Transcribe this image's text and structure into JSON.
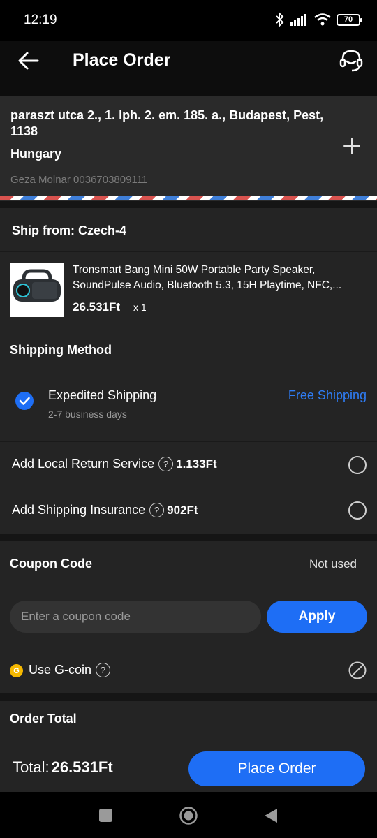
{
  "status_bar": {
    "time": "12:19",
    "battery": "70"
  },
  "app_bar": {
    "title": "Place Order"
  },
  "address": {
    "line": "paraszt utca 2., 1. lph. 2. em. 185. a., Budapest, Pest, 1138",
    "country": "Hungary",
    "contact": "Geza Molnar  0036703809111"
  },
  "ship_from": {
    "label": "Ship from: Czech-4"
  },
  "product": {
    "title_line1": "Tronsmart Bang Mini 50W Portable Party Speaker,",
    "title_line2": "SoundPulse Audio,  Bluetooth 5.3, 15H Playtime, NFC,...",
    "price": "26.531Ft",
    "qty": "x 1"
  },
  "shipping": {
    "heading": "Shipping Method",
    "method": "Expedited Shipping",
    "days": "2-7 business days",
    "price_label": "Free Shipping"
  },
  "addons": {
    "return_label": "Add Local Return Service",
    "return_price": "1.133Ft",
    "insurance_label": "Add Shipping Insurance",
    "insurance_price": "902Ft"
  },
  "coupon": {
    "heading": "Coupon Code",
    "status": "Not used",
    "placeholder": "Enter a coupon code",
    "apply_label": "Apply",
    "gcoin_label": "Use G-coin"
  },
  "order_total": {
    "heading": "Order Total",
    "total_label": "Total:",
    "total_value": "26.531Ft",
    "place_order_label": "Place Order"
  },
  "colors": {
    "accent": "#1e6ef5",
    "link": "#2f7df6",
    "background": "#242424"
  }
}
